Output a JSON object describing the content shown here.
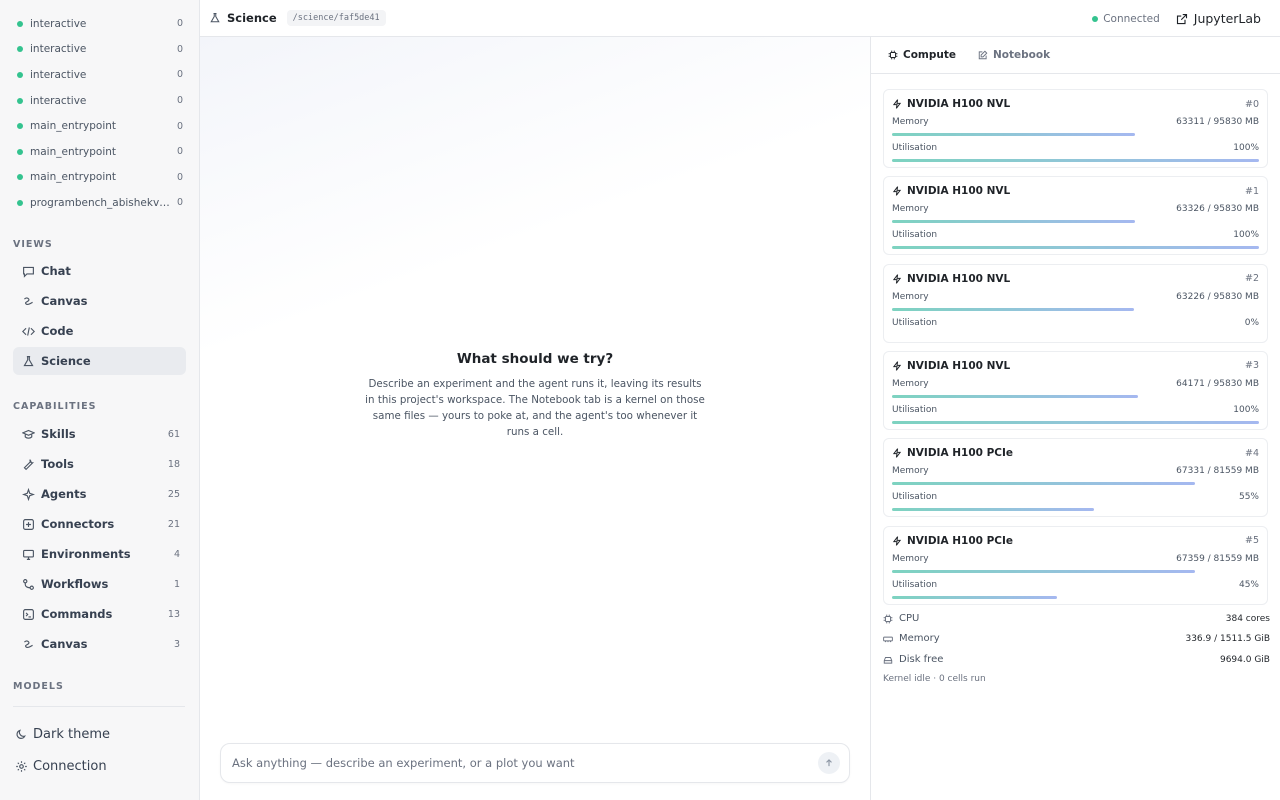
{
  "sidebar": {
    "sessions": [
      {
        "name": "interactive",
        "count": "0"
      },
      {
        "name": "interactive",
        "count": "0"
      },
      {
        "name": "interactive",
        "count": "0"
      },
      {
        "name": "interactive",
        "count": "0"
      },
      {
        "name": "main_entrypoint",
        "count": "0"
      },
      {
        "name": "main_entrypoint",
        "count": "0"
      },
      {
        "name": "main_entrypoint",
        "count": "0"
      },
      {
        "name": "programbench_abishekvas...",
        "count": "0"
      }
    ],
    "views_title": "VIEWS",
    "views": [
      {
        "label": "Chat",
        "icon": "chat-icon"
      },
      {
        "label": "Canvas",
        "icon": "canvas-icon"
      },
      {
        "label": "Code",
        "icon": "code-icon"
      },
      {
        "label": "Science",
        "icon": "flask-icon",
        "active": true
      }
    ],
    "capabilities_title": "CAPABILITIES",
    "capabilities": [
      {
        "label": "Skills",
        "count": "61",
        "icon": "skills-icon"
      },
      {
        "label": "Tools",
        "count": "18",
        "icon": "wrench-icon"
      },
      {
        "label": "Agents",
        "count": "25",
        "icon": "sparkle-icon"
      },
      {
        "label": "Connectors",
        "count": "21",
        "icon": "connector-icon"
      },
      {
        "label": "Environments",
        "count": "4",
        "icon": "monitor-icon"
      },
      {
        "label": "Workflows",
        "count": "1",
        "icon": "workflow-icon"
      },
      {
        "label": "Commands",
        "count": "13",
        "icon": "terminal-icon"
      },
      {
        "label": "Canvas",
        "count": "3",
        "icon": "canvas-icon"
      }
    ],
    "models_title": "MODELS",
    "footer": {
      "dark_theme": "Dark theme",
      "connection": "Connection"
    }
  },
  "topbar": {
    "title": "Science",
    "path": "/science/faf5de41",
    "status": "Connected",
    "status_color": "#34c38f",
    "jupyter_label": "JupyterLab"
  },
  "main": {
    "empty_title": "What should we try?",
    "empty_body": "Describe an experiment and the agent runs it, leaving its results in this project's workspace. The Notebook tab is a kernel on those same files — yours to poke at, and the agent's too whenever it runs a cell.",
    "composer_placeholder": "Ask anything — describe an experiment, or a plot you want"
  },
  "panel": {
    "tabs": {
      "compute": "Compute",
      "notebook": "Notebook"
    },
    "memory_label": "Memory",
    "util_label": "Utilisation",
    "gpus": [
      {
        "name": "NVIDIA H100 NVL",
        "index": "#0",
        "memory": "63311 / 95830 MB",
        "mem_frac": 0.661,
        "util": "100%",
        "util_frac": 1.0
      },
      {
        "name": "NVIDIA H100 NVL",
        "index": "#1",
        "memory": "63326 / 95830 MB",
        "mem_frac": 0.661,
        "util": "100%",
        "util_frac": 1.0
      },
      {
        "name": "NVIDIA H100 NVL",
        "index": "#2",
        "memory": "63226 / 95830 MB",
        "mem_frac": 0.66,
        "util": "0%",
        "util_frac": 0.0
      },
      {
        "name": "NVIDIA H100 NVL",
        "index": "#3",
        "memory": "64171 / 95830 MB",
        "mem_frac": 0.67,
        "util": "100%",
        "util_frac": 1.0
      },
      {
        "name": "NVIDIA H100 PCIe",
        "index": "#4",
        "memory": "67331 / 81559 MB",
        "mem_frac": 0.826,
        "util": "55%",
        "util_frac": 0.55
      },
      {
        "name": "NVIDIA H100 PCIe",
        "index": "#5",
        "memory": "67359 / 81559 MB",
        "mem_frac": 0.826,
        "util": "45%",
        "util_frac": 0.45
      }
    ],
    "system": [
      {
        "label": "CPU",
        "value": "384 cores",
        "icon": "cpu-icon"
      },
      {
        "label": "Memory",
        "value": "336.9 / 1511.5 GiB",
        "icon": "memory-icon"
      },
      {
        "label": "Disk free",
        "value": "9694.0 GiB",
        "icon": "disk-icon"
      }
    ],
    "kernel_status": "Kernel idle · 0 cells run"
  }
}
